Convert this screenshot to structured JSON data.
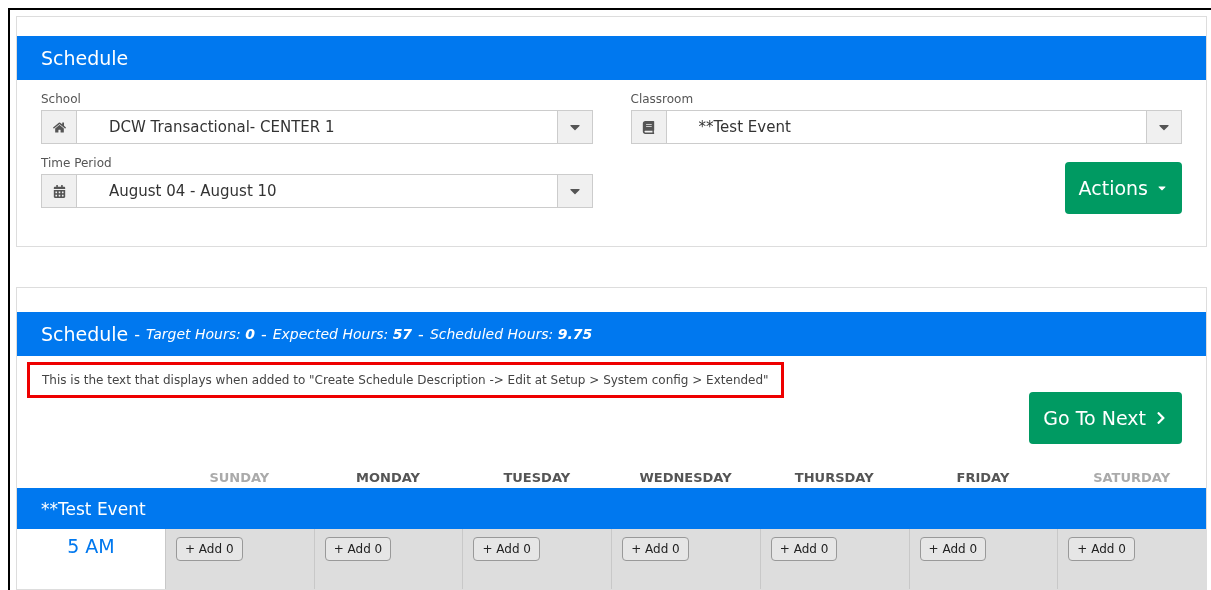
{
  "filters_panel": {
    "title": "Schedule",
    "fields": [
      {
        "label": "School",
        "value": "DCW Transactional- CENTER 1"
      },
      {
        "label": "Classroom",
        "value": "**Test Event"
      },
      {
        "label": "Time Period",
        "value": "August 04 - August 10"
      }
    ],
    "actions_button": "Actions"
  },
  "schedule_panel": {
    "title": "Schedule",
    "stats": [
      {
        "separator": "-",
        "label": "Target Hours:",
        "value": "0"
      },
      {
        "separator": "-",
        "label": "Expected Hours:",
        "value": "57"
      },
      {
        "separator": "-",
        "label": "Scheduled Hours:",
        "value": "9.75"
      }
    ],
    "description": {
      "text": "This is the text that displays when added to \"Create Schedule Description -> Edit at Setup > System config > Extended\"",
      "highlighted": true
    },
    "next_button": "Go To Next",
    "days": [
      {
        "label": "SUNDAY",
        "muted": true
      },
      {
        "label": "MONDAY",
        "muted": false
      },
      {
        "label": "TUESDAY",
        "muted": false
      },
      {
        "label": "WEDNESDAY",
        "muted": false
      },
      {
        "label": "THURSDAY",
        "muted": false
      },
      {
        "label": "FRIDAY",
        "muted": false
      },
      {
        "label": "SATURDAY",
        "muted": true
      }
    ],
    "group": "**Test Event",
    "rows": [
      {
        "time": "5 AM",
        "cells": [
          "+ Add 0",
          "+ Add 0",
          "+ Add 0",
          "+ Add 0",
          "+ Add 0",
          "+ Add 0",
          "+ Add 0"
        ]
      }
    ]
  }
}
